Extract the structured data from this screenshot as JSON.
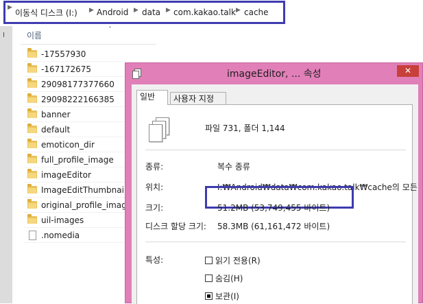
{
  "address": {
    "crumbs": [
      "이동식 디스크 (I:)",
      "Android",
      "data",
      "com.kakao.talk",
      "cache"
    ]
  },
  "filelist": {
    "column_name": "이름",
    "items": [
      {
        "name": "-17557930",
        "type": "folder"
      },
      {
        "name": "-167172675",
        "type": "folder"
      },
      {
        "name": "29098177377660",
        "type": "folder"
      },
      {
        "name": "29098222166385",
        "type": "folder"
      },
      {
        "name": "banner",
        "type": "folder"
      },
      {
        "name": "default",
        "type": "folder"
      },
      {
        "name": "emoticon_dir",
        "type": "folder"
      },
      {
        "name": "full_profile_image",
        "type": "folder"
      },
      {
        "name": "imageEditor",
        "type": "folder"
      },
      {
        "name": "ImageEditThumbnail",
        "type": "folder"
      },
      {
        "name": "original_profile_image",
        "type": "folder"
      },
      {
        "name": "uil-images",
        "type": "folder"
      },
      {
        "name": ".nomedia",
        "type": "file"
      }
    ]
  },
  "dialog": {
    "title": "imageEditor, ... 속성",
    "close_label": "✕",
    "tabs": [
      {
        "label": "일반",
        "active": true
      },
      {
        "label": "사용자 지정",
        "active": false
      }
    ],
    "summary": "파일 731, 폴더 1,144",
    "properties": {
      "type_label": "종류:",
      "type_value": "복수 종류",
      "location_label": "위치:",
      "location_value": "I:₩Android₩data₩com.kakao.talk₩cache의 모든",
      "size_label": "크기:",
      "size_value": "51.2MB (53,749,455 바이트)",
      "disk_label": "디스크 할당 크기:",
      "disk_value": "58.3MB (61,161,472 바이트)"
    },
    "attributes": {
      "label": "특성:",
      "readonly": {
        "label": "읽기 전용(R)",
        "checked": false
      },
      "hidden": {
        "label": "숨김(H)",
        "checked": false
      },
      "archive": {
        "label": "보관(I)",
        "checked": true
      }
    }
  },
  "colors": {
    "highlight_box": "#3e3bb0",
    "dialog_frame": "#e17fb8",
    "close_button": "#c7403b",
    "folder": "#e9c25a"
  }
}
